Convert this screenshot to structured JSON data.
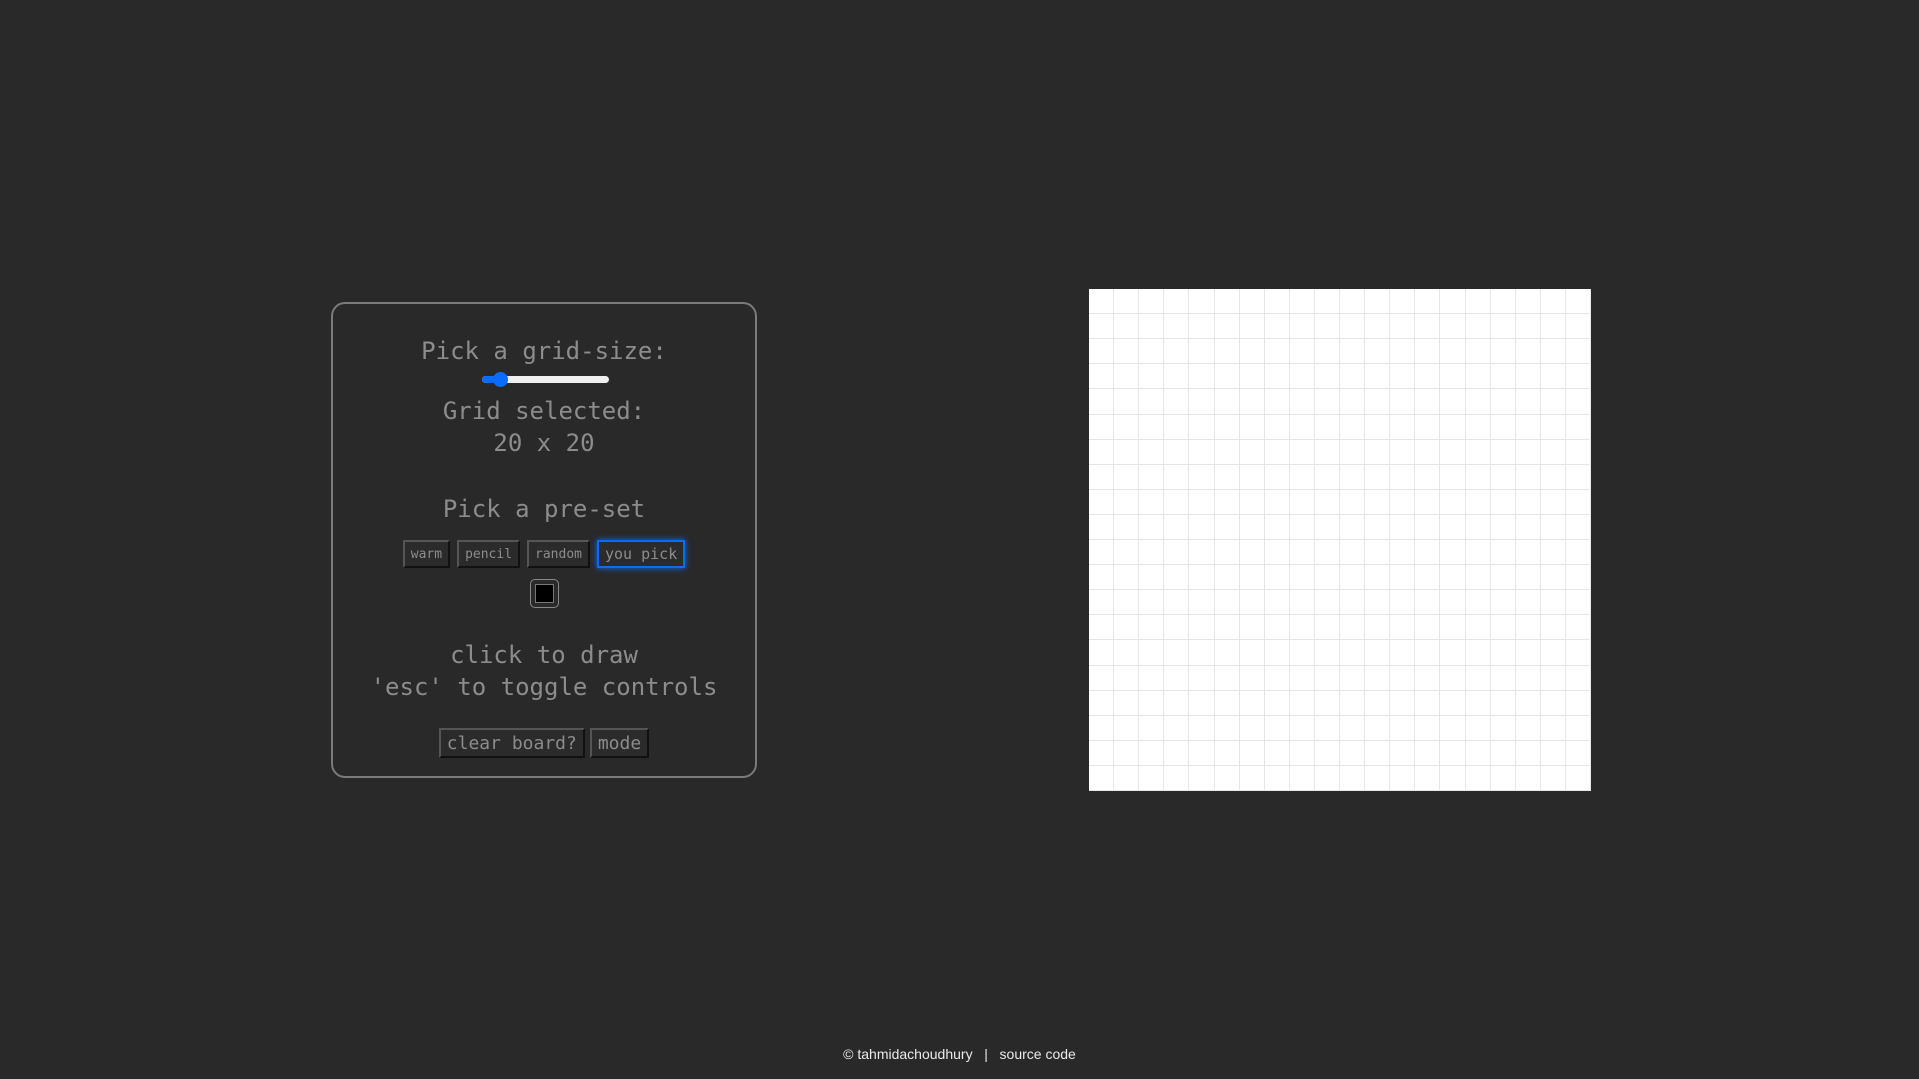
{
  "controls": {
    "grid_size_label": "Pick a grid-size:",
    "grid_size_slider_fraction": 0.09,
    "grid_selected_label": "Grid selected:",
    "grid_selected_value": "20 x 20",
    "preset_label": "Pick a pre-set",
    "presets": [
      "warm",
      "pencil",
      "random",
      "you pick"
    ],
    "active_preset": "you pick",
    "picked_color": "#000000",
    "instructions": [
      "click to draw",
      "'esc' to toggle controls"
    ],
    "clear_label": "clear board?",
    "mode_label": "mode"
  },
  "board": {
    "rows": 20,
    "cols": 20,
    "background": "#ffffff"
  },
  "footer": {
    "author": "© tahmidachoudhury",
    "separator": "|",
    "source_link": "source code"
  },
  "colors": {
    "accent": "#0a6cff",
    "background": "#292929"
  }
}
